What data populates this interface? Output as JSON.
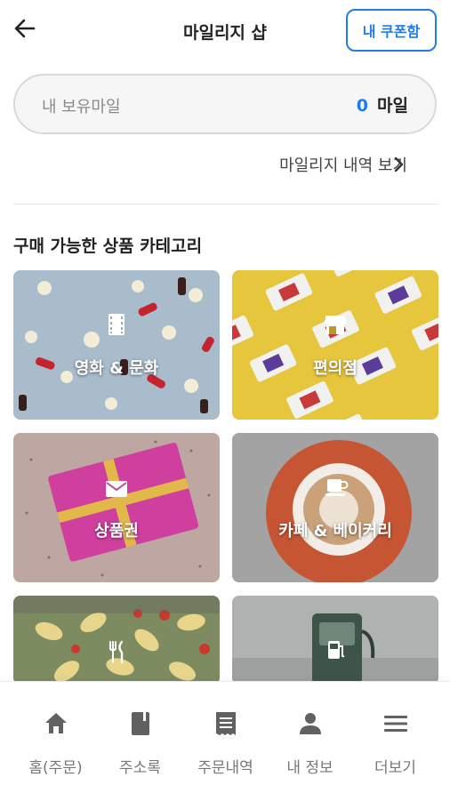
{
  "header": {
    "title": "마일리지 샵",
    "coupon_button": "내 쿠폰함"
  },
  "mileage": {
    "label": "내 보유마일",
    "value": "0",
    "unit": "마일",
    "history_link": "마일리지 내역 보기"
  },
  "categories": {
    "title": "구매 가능한 상품 카테고리",
    "items": [
      {
        "label": "영화 & 문화",
        "icon": "film-icon"
      },
      {
        "label": "편의점",
        "icon": "store-icon"
      },
      {
        "label": "상품권",
        "icon": "envelope-icon"
      },
      {
        "label": "카페 & 베이커리",
        "icon": "coffee-cup-icon"
      },
      {
        "label": "",
        "icon": "fork-knife-icon"
      },
      {
        "label": "",
        "icon": "gas-pump-icon"
      }
    ]
  },
  "bottom_nav": {
    "items": [
      {
        "label": "홈(주문)",
        "icon": "home-icon"
      },
      {
        "label": "주소록",
        "icon": "address-book-icon"
      },
      {
        "label": "주문내역",
        "icon": "receipt-icon"
      },
      {
        "label": "내 정보",
        "icon": "person-icon"
      },
      {
        "label": "더보기",
        "icon": "menu-icon"
      }
    ]
  },
  "colors": {
    "accent": "#1f7cf0",
    "text": "#222222",
    "muted": "#8a8a8a"
  }
}
